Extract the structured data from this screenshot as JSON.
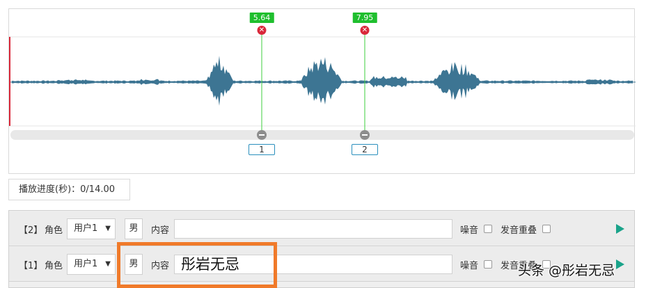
{
  "waveform": {
    "markers": [
      {
        "time": "5.64",
        "delete_glyph": "✕",
        "index": "1"
      },
      {
        "time": "7.95",
        "delete_glyph": "✕",
        "index": "2"
      }
    ],
    "colors": {
      "wave": "#3d7593",
      "marker_line": "#3ccf3c",
      "playhead": "#d9283a"
    }
  },
  "progress": {
    "text": "播放进度(秒)：0/14.00"
  },
  "segments": [
    {
      "index": "【2】",
      "role_label": "角色",
      "role_value": "用户1",
      "caret": "▼",
      "gender": "男",
      "content_label": "内容",
      "content_value": "",
      "noise_label": "噪音",
      "overlap_label": "发音重叠"
    },
    {
      "index": "【1】",
      "role_label": "角色",
      "role_value": "用户1",
      "caret": "▼",
      "gender": "男",
      "content_label": "内容",
      "content_value": "彤岩无忌",
      "noise_label": "噪音",
      "overlap_label": "发音重叠"
    }
  ],
  "watermark": {
    "text": "头条 @彤岩无忌"
  },
  "icons": {
    "delete": "close-circle-icon",
    "handle": "drag-handle-icon",
    "play": "play-icon",
    "dropdown": "chevron-down-icon"
  }
}
